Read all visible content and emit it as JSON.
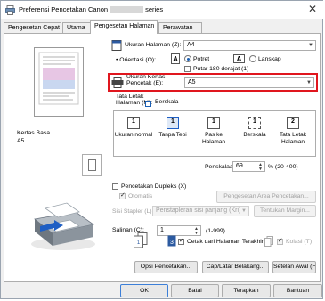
{
  "window": {
    "title_prefix": "Preferensi Pencetakan Canon",
    "title_suffix": "series",
    "close": "✕"
  },
  "tabs": [
    {
      "label": "Pengesetan Cepat"
    },
    {
      "label": "Utama"
    },
    {
      "label": "Pengesetan Halaman"
    },
    {
      "label": "Perawatan"
    }
  ],
  "preview": {
    "media_label": "Kertas Basa",
    "media_size": "A5"
  },
  "page_size": {
    "label": "Ukuran Halaman (Z):",
    "value": "A4"
  },
  "orientation": {
    "label": "Orientasi (O):",
    "portrait": "Potret",
    "landscape": "Lanskap",
    "rotate180": "Putar 180 derajat (1)"
  },
  "printer_paper": {
    "label_line1": "Ukuran Kertas",
    "label_line2": "Pencetak (E):",
    "value": "A5"
  },
  "layout": {
    "label_line1": "Tata Letak",
    "label_line2": "Halaman (M):",
    "current": "Berskala",
    "options": [
      {
        "caption": "Ukuran normal",
        "glyph": "1"
      },
      {
        "caption": "Tanpa Tepi",
        "glyph": "1"
      },
      {
        "caption": "Pas ke Halaman",
        "glyph": "1"
      },
      {
        "caption": "Berskala",
        "glyph": "1"
      },
      {
        "caption": "Tata Letak Halaman",
        "glyph": "2"
      }
    ]
  },
  "scaling": {
    "label": "Penskalaan:",
    "value": "69",
    "range": "% (20-400)"
  },
  "duplex": {
    "label": "Pencetakan Dupleks (X)",
    "auto": "Otomatis",
    "area_button": "Pengesetan Area Pencetakan..."
  },
  "stapling": {
    "label": "Sisi Stapler (L):",
    "value": "Penstapleran sisi panjang (Kri)",
    "margin_button": "Tentukan Margin..."
  },
  "copies": {
    "label": "Salinan (C):",
    "value": "1",
    "range": "(1-999)",
    "last_page_first": "Cetak dari Halaman Terakhir (R)",
    "collate": "Kolasi (T)"
  },
  "buttons": {
    "print_options": "Opsi Pencetakan...",
    "stamp_background": "Cap/Latar Belakang...",
    "defaults": "Setelan Awal (F)",
    "ok": "OK",
    "cancel": "Batal",
    "apply": "Terapkan",
    "help": "Bantuan"
  }
}
